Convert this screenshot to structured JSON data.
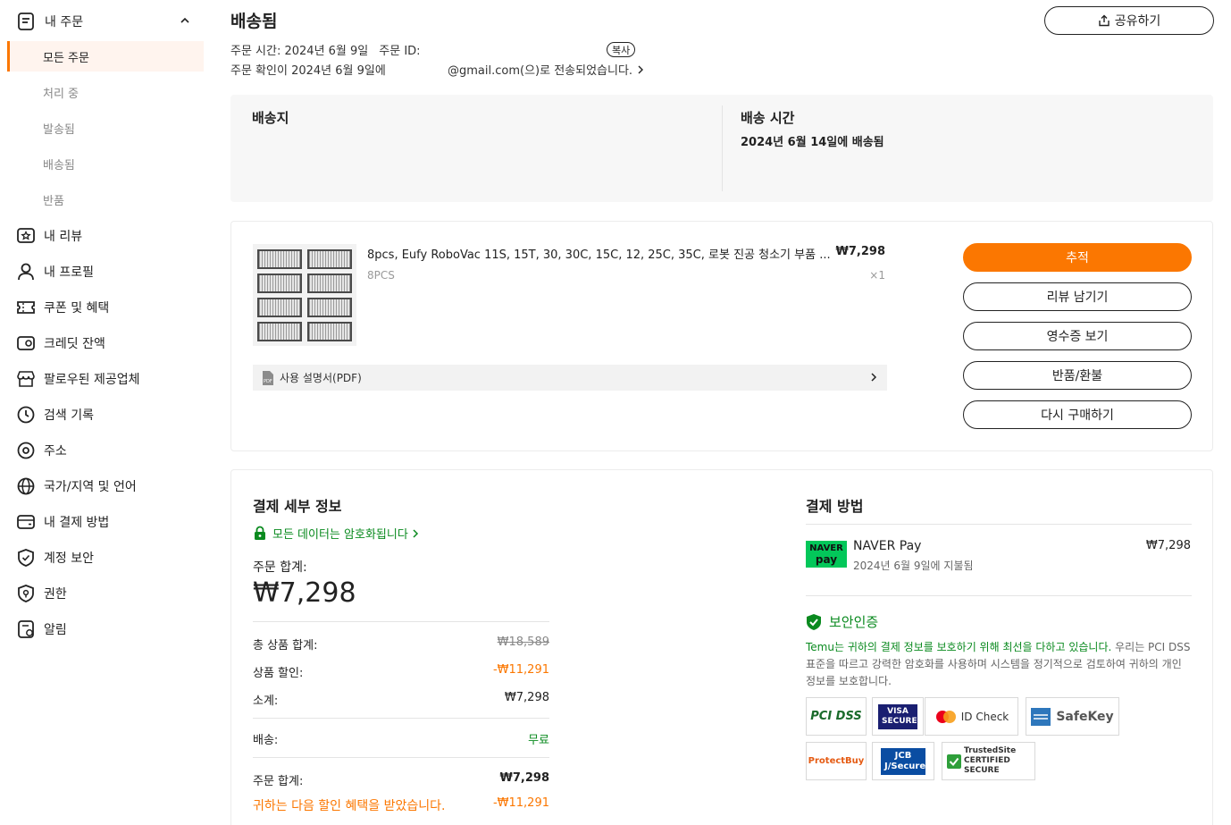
{
  "sidebar": {
    "section_label": "내 주문",
    "sub_items": [
      "모든 주문",
      "처리 중",
      "발송됨",
      "배송됨",
      "반품"
    ],
    "nav_items": [
      {
        "label": "내 리뷰",
        "icon": "review-icon"
      },
      {
        "label": "내 프로필",
        "icon": "profile-icon"
      },
      {
        "label": "쿠폰 및 혜택",
        "icon": "coupon-icon"
      },
      {
        "label": "크레딧 잔액",
        "icon": "credit-icon"
      },
      {
        "label": "팔로우된 제공업체",
        "icon": "store-icon"
      },
      {
        "label": "검색 기록",
        "icon": "clock-icon"
      },
      {
        "label": "주소",
        "icon": "location-icon"
      },
      {
        "label": "국가/지역 및 언어",
        "icon": "globe-icon"
      },
      {
        "label": "내 결제 방법",
        "icon": "wallet-icon"
      },
      {
        "label": "계정 보안",
        "icon": "shield-icon"
      },
      {
        "label": "권한",
        "icon": "permission-icon"
      },
      {
        "label": "알림",
        "icon": "notification-icon"
      }
    ]
  },
  "header": {
    "title": "배송됨",
    "share_label": "공유하기",
    "order_time": "주문 시간: 2024년 6월 9일",
    "order_id_label": "주문 ID:",
    "copy_label": "복사",
    "confirm_prefix": "주문 확인이 2024년 6월 9일에",
    "confirm_suffix": "@gmail.com(으)로 전송되었습니다."
  },
  "shipping": {
    "address_title": "배송지",
    "time_title": "배송 시간",
    "time_value": "2024년 6월 14일에 배송됨"
  },
  "order": {
    "product_name": "8pcs, Eufy RoboVac 11S, 15T, 30, 30C, 15C, 12, 25C, 35C, 로봇 진공 청소기 부품 ...",
    "price": "₩7,298",
    "spec": "8PCS",
    "qty": "×1",
    "manual_label": "사용 설명서(PDF)",
    "actions": [
      "추적",
      "리뷰 남기기",
      "영수증 보기",
      "반품/환불",
      "다시 구매하기"
    ]
  },
  "payment": {
    "details_title": "결제 세부 정보",
    "secure_text": "모든 데이터는 암호화됩니다",
    "total_label": "주문 합계:",
    "total_big": "₩7,298",
    "rows": [
      {
        "label": "총 상품 합계:",
        "value": "₩18,589"
      },
      {
        "label": "상품 할인:",
        "value": "-₩11,291"
      },
      {
        "label": "소계:",
        "value": "₩7,298"
      },
      {
        "label": "배송:",
        "value": "무료"
      },
      {
        "label": "주문 합계:",
        "value": "₩7,298"
      },
      {
        "label": "귀하는 다음 할인 혜택을 받았습니다.",
        "value": "-₩11,291"
      }
    ],
    "method_title": "결제 방법",
    "naver_logo_top": "NAVER",
    "naver_logo_bottom": "pay",
    "naver_name": "NAVER Pay",
    "naver_date": "2024년 6월 9일에 지불됨",
    "naver_amount": "₩7,298",
    "cert_title": "보안인증",
    "cert_text_green": "Temu는 귀하의 결제 정보를 보호하기 위해 최선을 다하고 있습니다.",
    "cert_text_rest": " 우리는 PCI DSS 표준을 따르고 강력한 암호화를 사용하며 시스템을 정기적으로 검토하여 귀하의 개인 정보를 보호합니다.",
    "badges": [
      "PCI DSS",
      "VISA SECURE",
      "ID Check",
      "SafeKey",
      "ProtectBuy",
      "JCB J/Secure",
      "TrustedSite CERTIFIED SECURE"
    ]
  },
  "colors": {
    "accent": "#fb7701",
    "green": "#0a8a1f",
    "naver": "#03c75a"
  }
}
